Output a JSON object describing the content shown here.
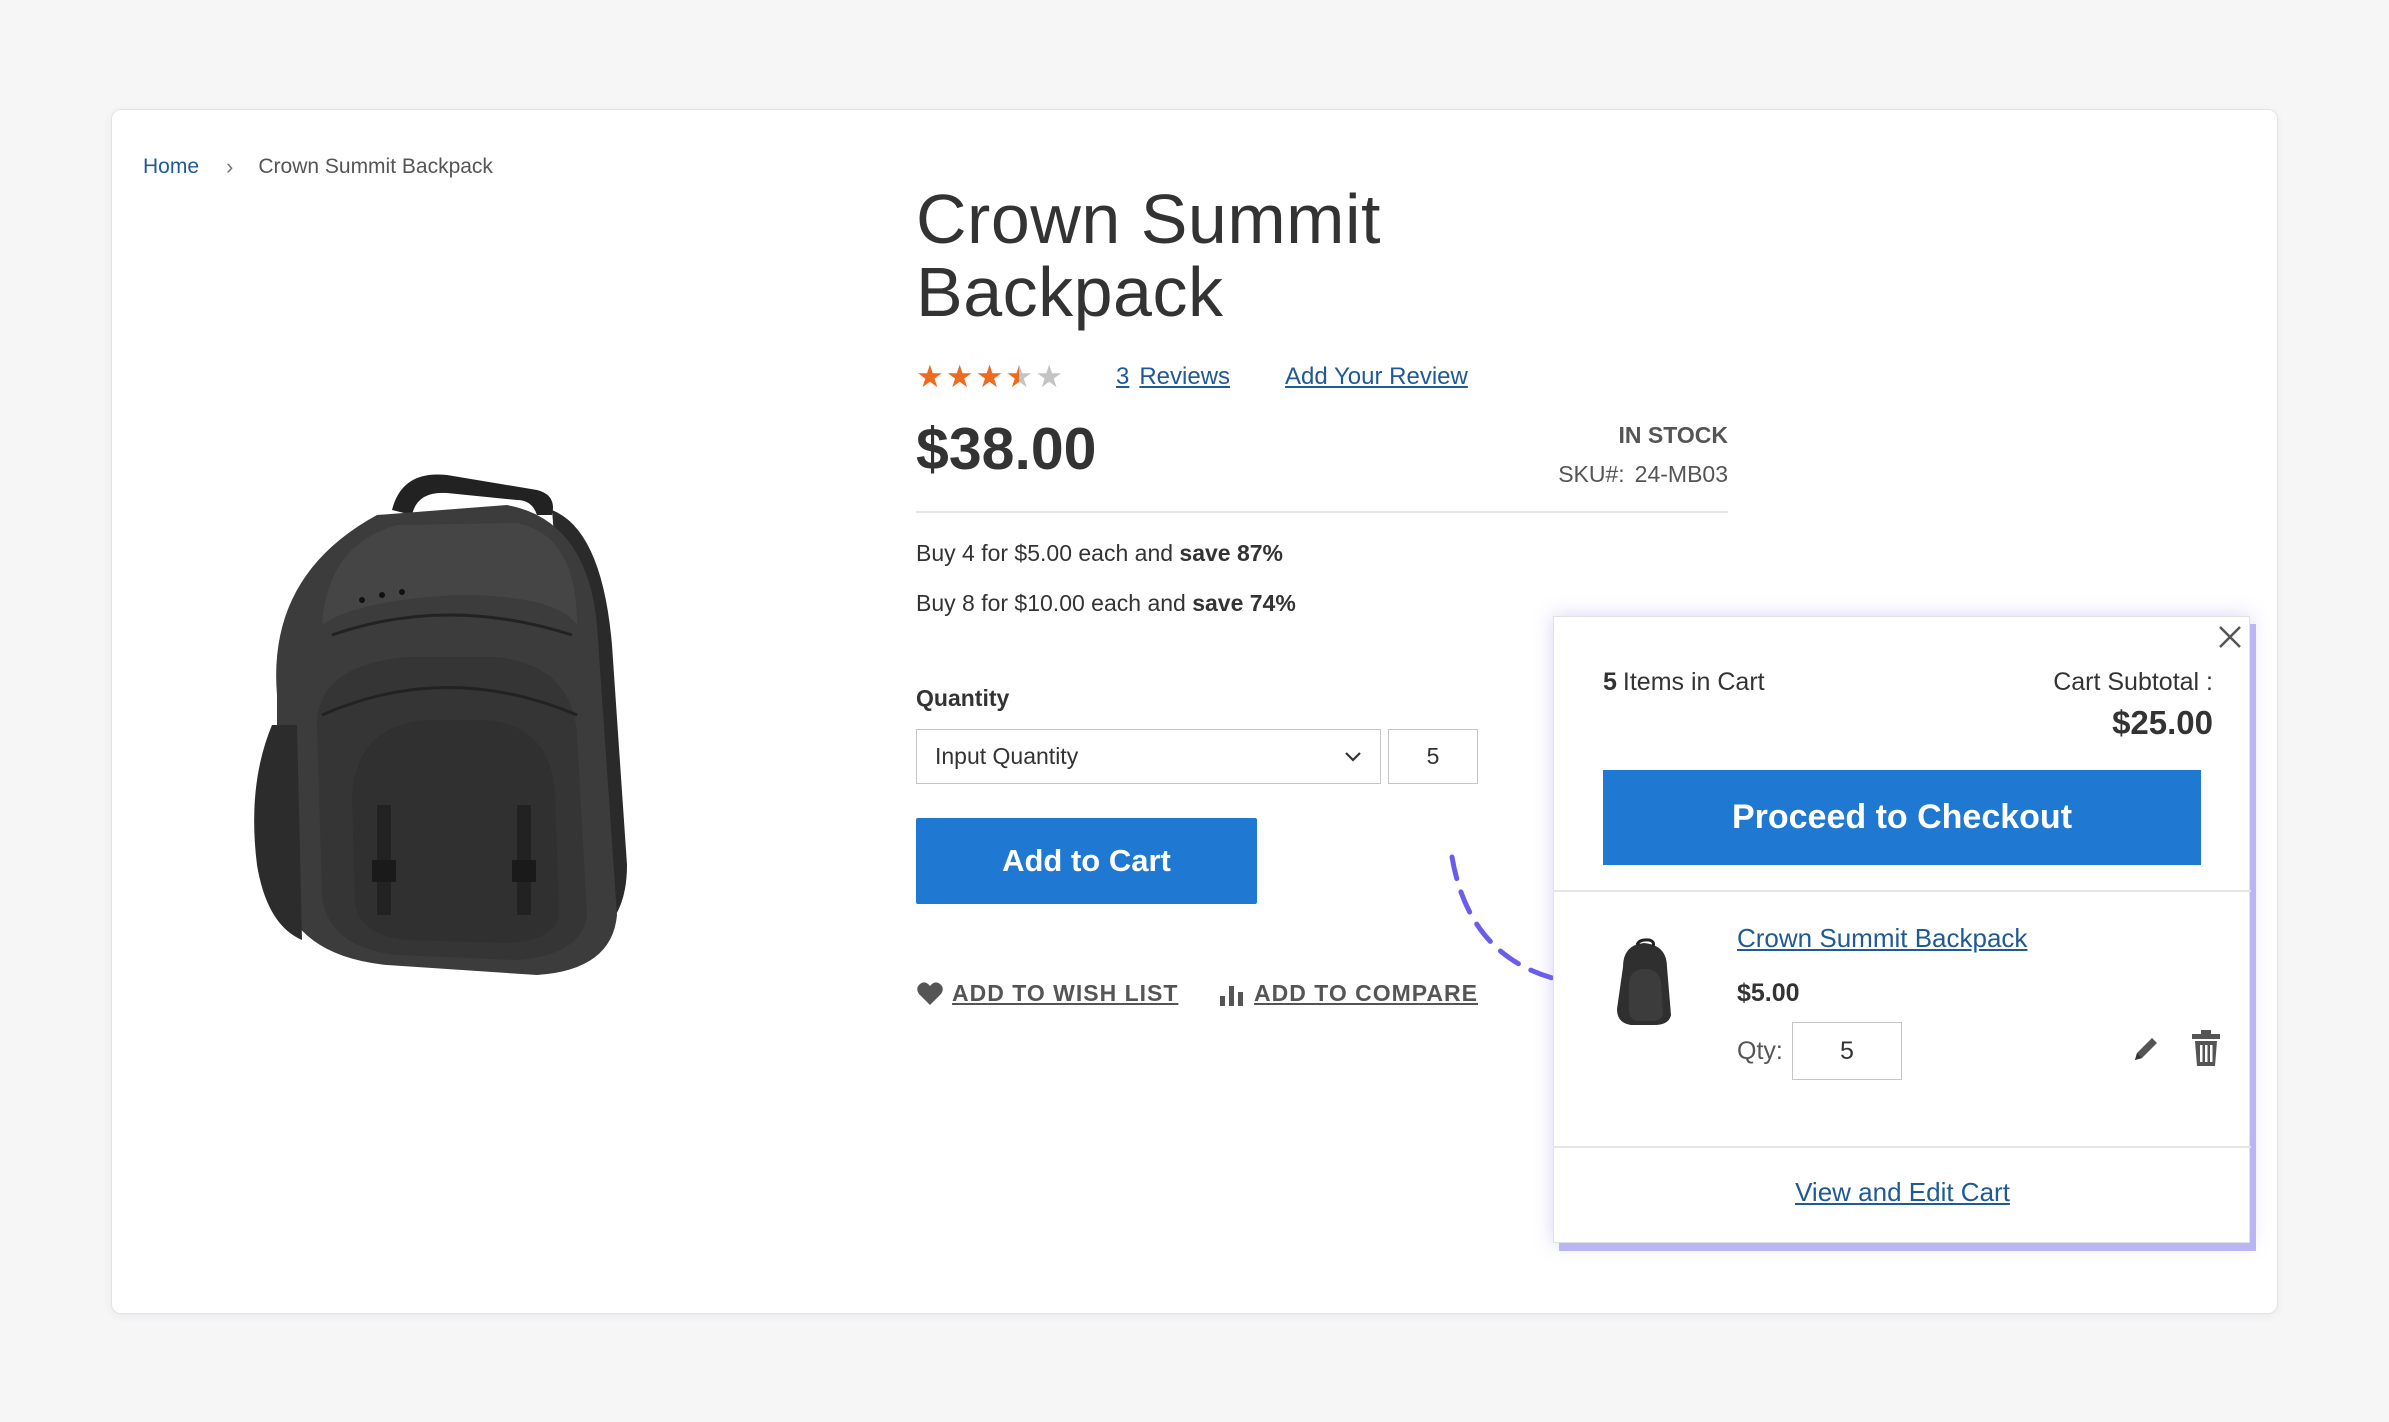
{
  "breadcrumb": {
    "home": "Home",
    "separator": "›",
    "current": "Crown Summit Backpack"
  },
  "product": {
    "image_icon": "backpack-image",
    "title": "Crown Summit Backpack",
    "rating": {
      "stars_filled": 3.5,
      "stars_total": 5,
      "color": "#ee6a1e"
    },
    "reviews_count": "3",
    "reviews_label": "Reviews",
    "add_review": "Add Your Review",
    "price": "$38.00",
    "stock": "IN STOCK",
    "sku_label": "SKU#:",
    "sku_value": "24-MB03",
    "tier_prices": [
      {
        "text": "Buy 4 for $5.00 each and ",
        "bold": "save 87%"
      },
      {
        "text": "Buy 8 for $10.00 each and ",
        "bold": "save 74%"
      }
    ],
    "quantity_label": "Quantity",
    "quantity_select": "Input Quantity",
    "quantity_value": "5",
    "add_to_cart": "Add to Cart",
    "wish_list": "ADD TO WISH LIST",
    "compare": "ADD TO COMPARE"
  },
  "minicart": {
    "items_count": "5",
    "items_label": "Items in Cart",
    "subtotal_label": "Cart Subtotal :",
    "subtotal": "$25.00",
    "checkout": "Proceed to Checkout",
    "item": {
      "name": "Crown Summit Backpack",
      "price": "$5.00",
      "qty_label": "Qty:",
      "qty_value": "5"
    },
    "view_edit": "View and Edit Cart"
  },
  "colors": {
    "primary": "#1f78d1",
    "link": "#1f5a94",
    "accent_arrow": "#6a5ee8",
    "arrow_green": "#b5ea2f"
  }
}
